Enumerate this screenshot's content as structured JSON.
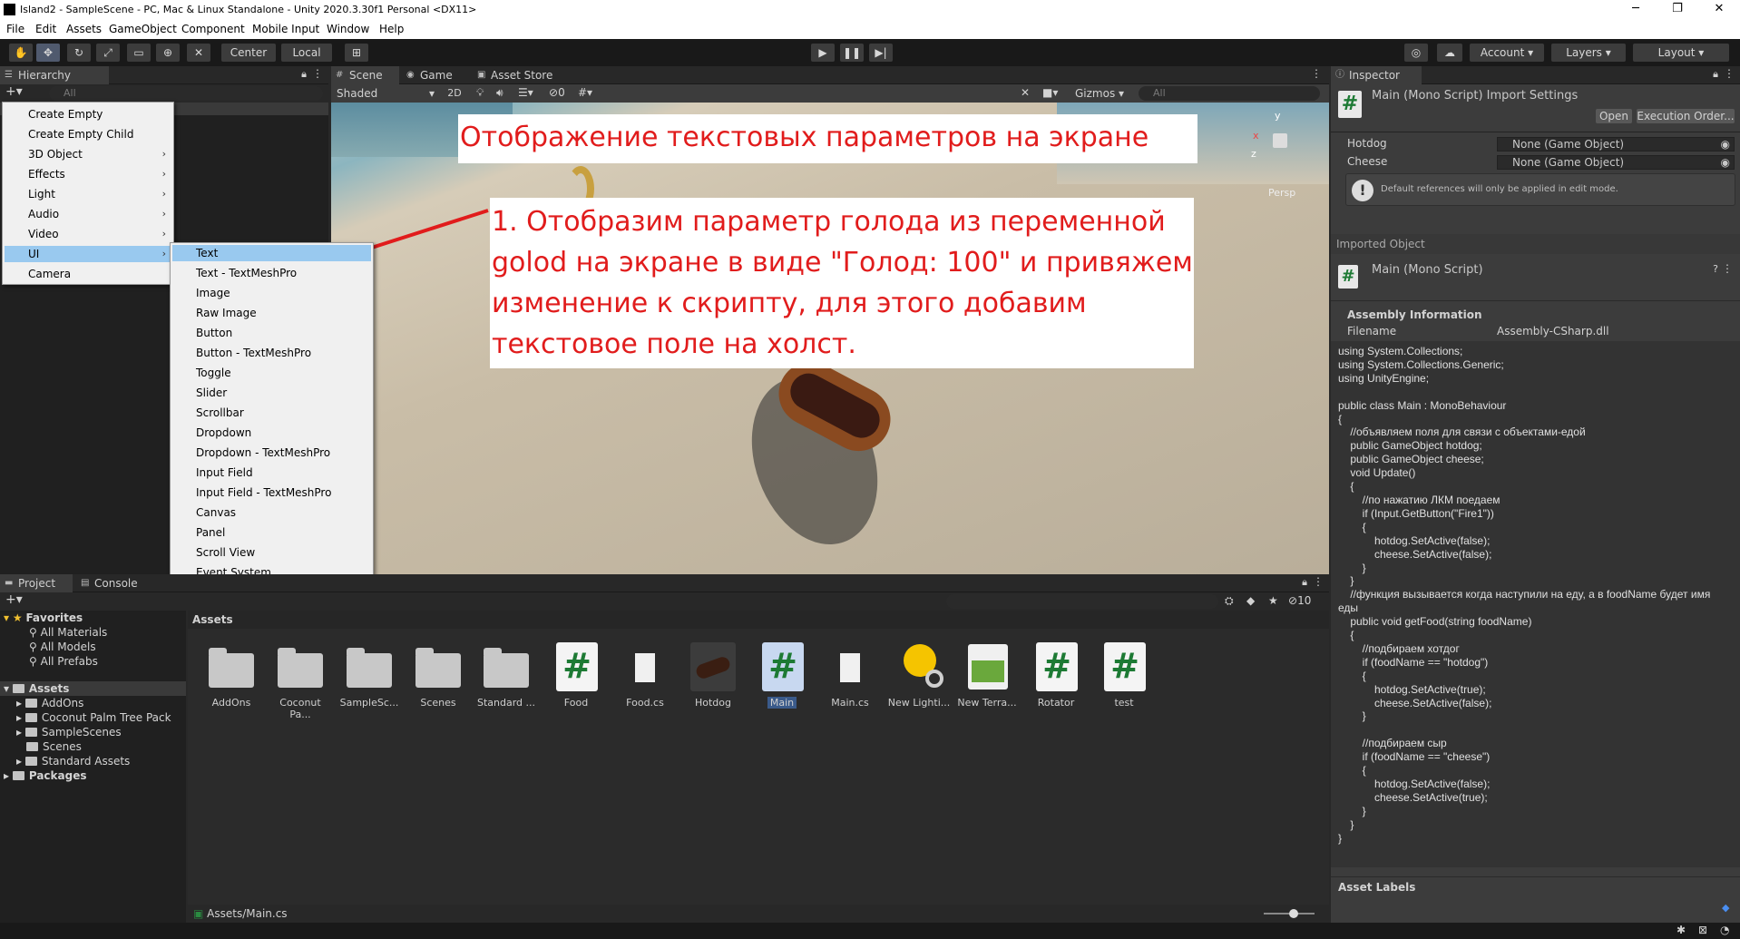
{
  "window": {
    "title": "Island2 - SampleScene - PC, Mac & Linux Standalone - Unity 2020.3.30f1 Personal <DX11>"
  },
  "menu": [
    "File",
    "Edit",
    "Assets",
    "GameObject",
    "Component",
    "Mobile Input",
    "Window",
    "Help"
  ],
  "toolbar": {
    "center": "Center",
    "local": "Local",
    "account": "Account",
    "layers": "Layers",
    "layout": "Layout"
  },
  "hierarchy": {
    "tab": "Hierarchy",
    "search_placeholder": "All"
  },
  "context_menu": [
    "Create Empty",
    "Create Empty Child",
    "3D Object",
    "Effects",
    "Light",
    "Audio",
    "Video",
    "UI",
    "Camera"
  ],
  "ui_submenu": [
    "Text",
    "Text - TextMeshPro",
    "Image",
    "Raw Image",
    "Button",
    "Button - TextMeshPro",
    "Toggle",
    "Slider",
    "Scrollbar",
    "Dropdown",
    "Dropdown - TextMeshPro",
    "Input Field",
    "Input Field - TextMeshPro",
    "Canvas",
    "Panel",
    "Scroll View",
    "Event System"
  ],
  "scene": {
    "tabs": [
      "Scene",
      "Game",
      "Asset Store"
    ],
    "shading": "Shaded",
    "mode2d": "2D",
    "hidden_count": "0",
    "gizmos": "Gizmos",
    "search_placeholder": "All",
    "persp": "Persp"
  },
  "annotations": {
    "title": "Отображение текстовых параметров на экране",
    "step": "1. Отобразим параметр голода из переменной golod на экране в виде \"Голод: 100\" и привяжем изменение к скрипту, для этого добавим текстовое поле на холст."
  },
  "inspector": {
    "tab": "Inspector",
    "title": "Main (Mono Script) Import Settings",
    "open_label": "Open",
    "exec_order_label": "Execution Order...",
    "fields": [
      {
        "label": "Hotdog",
        "value": "None (Game Object)"
      },
      {
        "label": "Cheese",
        "value": "None (Game Object)"
      }
    ],
    "info": "Default references will only be applied in edit mode.",
    "imported_object": "Imported Object",
    "script_name": "Main (Mono Script)",
    "assembly_header": "Assembly Information",
    "filename_label": "Filename",
    "filename_value": "Assembly-CSharp.dll",
    "code": "using System.Collections;\nusing System.Collections.Generic;\nusing UnityEngine;\n\npublic class Main : MonoBehaviour\n{\n    //объявляем поля для связи с объектами-едой\n    public GameObject hotdog;\n    public GameObject cheese;\n    void Update()\n    {\n        //по нажатию ЛКМ поедаем\n        if (Input.GetButton(\"Fire1\"))\n        {\n            hotdog.SetActive(false);\n            cheese.SetActive(false);\n        }\n    }\n    //функция вызывается когда наступили на еду, а в foodName будет имя\nеды\n    public void getFood(string foodName)\n    {\n        //подбираем хотдог\n        if (foodName == \"hotdog\")\n        {\n            hotdog.SetActive(true);\n            cheese.SetActive(false);\n        }\n\n        //подбираем сыр\n        if (foodName == \"cheese\")\n        {\n            hotdog.SetActive(false);\n            cheese.SetActive(true);\n        }\n    }\n}",
    "asset_labels": "Asset Labels"
  },
  "project": {
    "tabs": [
      "Project",
      "Console"
    ],
    "favorites_label": "Favorites",
    "favorites": [
      "All Materials",
      "All Models",
      "All Prefabs"
    ],
    "assets_label": "Assets",
    "asset_folders": [
      "AddOns",
      "Coconut Palm Tree Pack",
      "SampleScenes",
      "Scenes",
      "Standard Assets"
    ],
    "packages_label": "Packages",
    "breadcrumb": "Assets",
    "hidden_count": "10",
    "items": [
      {
        "name": "AddOns",
        "kind": "folder"
      },
      {
        "name": "Coconut Pa...",
        "kind": "folder"
      },
      {
        "name": "SampleSc...",
        "kind": "folder"
      },
      {
        "name": "Scenes",
        "kind": "folder"
      },
      {
        "name": "Standard ...",
        "kind": "folder"
      },
      {
        "name": "Food",
        "kind": "script"
      },
      {
        "name": "Food.cs",
        "kind": "file"
      },
      {
        "name": "Hotdog",
        "kind": "model"
      },
      {
        "name": "Main",
        "kind": "script"
      },
      {
        "name": "Main.cs",
        "kind": "file"
      },
      {
        "name": "New Lighti...",
        "kind": "lighting"
      },
      {
        "name": "New Terra...",
        "kind": "terrain"
      },
      {
        "name": "Rotator",
        "kind": "script"
      },
      {
        "name": "test",
        "kind": "script"
      }
    ],
    "status_path": "Assets/Main.cs"
  }
}
